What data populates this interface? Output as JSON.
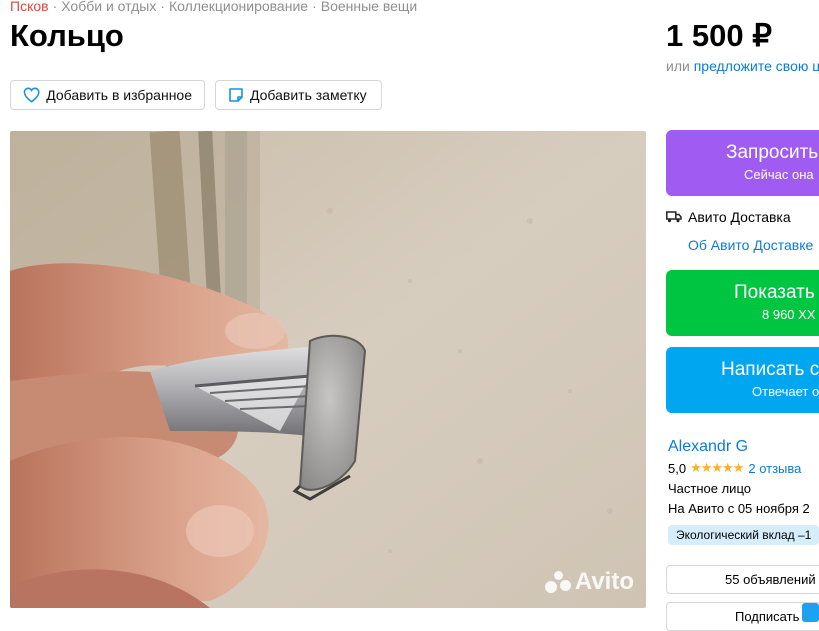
{
  "breadcrumb": [
    "Псков",
    "Хобби и отдых",
    "Коллекционирование",
    "Военные вещи"
  ],
  "title": "Кольцо",
  "price": "1 500 ₽",
  "offer": {
    "prefix": "или",
    "link": "предложите свою це"
  },
  "actions": {
    "favorite": "Добавить в избранное",
    "note": "Добавить заметку"
  },
  "watermark": "Avito",
  "cta": {
    "request": {
      "main": "Запросить",
      "sub": "Сейчас она"
    },
    "show_phone": {
      "main": "Показать",
      "sub": "8 960 XX"
    },
    "write": {
      "main": "Написать с",
      "sub": "Отвечает о"
    }
  },
  "delivery": {
    "label": "Авито Доставка",
    "link": "Об Авито Доставке"
  },
  "seller": {
    "name": "Alexandr G",
    "rating": "5,0",
    "stars": "★★★★★",
    "reviews": "2 отзыва",
    "type": "Частное лицо",
    "since": "На Авито с 05 ноября 2",
    "eco_badge": "Экологический вклад –1",
    "ads_button": "55 объявлений",
    "subscribe_button": "Подписать"
  },
  "colors": {
    "breadcrumb_accent": "#e0473b",
    "link": "#0a7bd8",
    "purple": "#a05cf2",
    "green": "#00c541",
    "blue": "#00a7f0"
  }
}
